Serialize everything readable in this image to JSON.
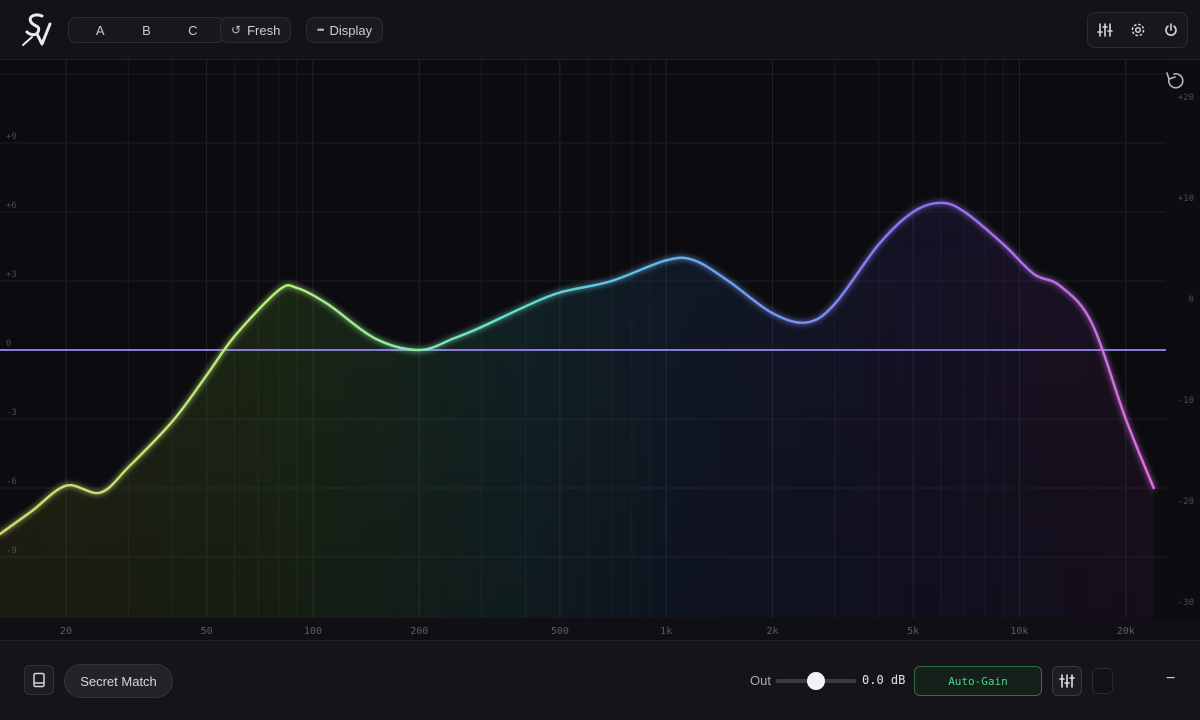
{
  "header": {
    "logo_text": "SV",
    "abc": [
      "A",
      "B",
      "C"
    ],
    "fresh_label": "Fresh",
    "fresh_icon": "↺",
    "display_label": "Display",
    "display_icon": "•••",
    "right_icons": [
      "sliders-icon",
      "gear-icon",
      "power-icon"
    ]
  },
  "graph": {
    "left_db_labels": [
      "+9",
      "+6",
      "+3",
      "0",
      "-3",
      "-6",
      "-9"
    ],
    "right_db_labels": [
      "+20",
      "+10",
      "0",
      "-10",
      "-20",
      "-30"
    ],
    "freq_labels": [
      "20",
      "50",
      "100",
      "200",
      "500",
      "1k",
      "2k",
      "5k",
      "10k",
      "20k"
    ],
    "reset_icon": "reset-icon"
  },
  "chart_data": {
    "type": "line",
    "xlabel": "",
    "ylabel": "",
    "x_scale": "log",
    "xlim": [
      13,
      26000
    ],
    "ylim": [
      -11,
      12
    ],
    "grid": true,
    "x": [
      13,
      16,
      20,
      25,
      30,
      40,
      50,
      60,
      80,
      90,
      110,
      150,
      200,
      250,
      300,
      400,
      500,
      700,
      1000,
      1200,
      1500,
      2000,
      2500,
      3000,
      4000,
      5000,
      6000,
      7000,
      9000,
      11000,
      13000,
      16000,
      20000,
      24000
    ],
    "y": [
      -8.0,
      -7.0,
      -5.9,
      -6.2,
      -5.1,
      -3.1,
      -1.1,
      0.6,
      2.6,
      2.7,
      2.0,
      0.5,
      0.0,
      0.5,
      1.0,
      1.9,
      2.5,
      3.0,
      3.9,
      3.9,
      3.0,
      1.6,
      1.2,
      2.0,
      4.6,
      6.0,
      6.4,
      6.0,
      4.6,
      3.3,
      2.8,
      1.2,
      -3.0,
      -6.0
    ],
    "colors": [
      "#c6d96a",
      "#b8f07a",
      "#5fe3d4",
      "#6aa3f0",
      "#8a70f0",
      "#d86ad8"
    ],
    "zero_line_color": "#8a7ad9"
  },
  "footer": {
    "secret_match_label": "Secret Match",
    "out_label": "Out",
    "out_value": "0.0 dB",
    "out_level": 0.5,
    "autogain_label": "Auto-Gain",
    "minus_label": "−"
  }
}
